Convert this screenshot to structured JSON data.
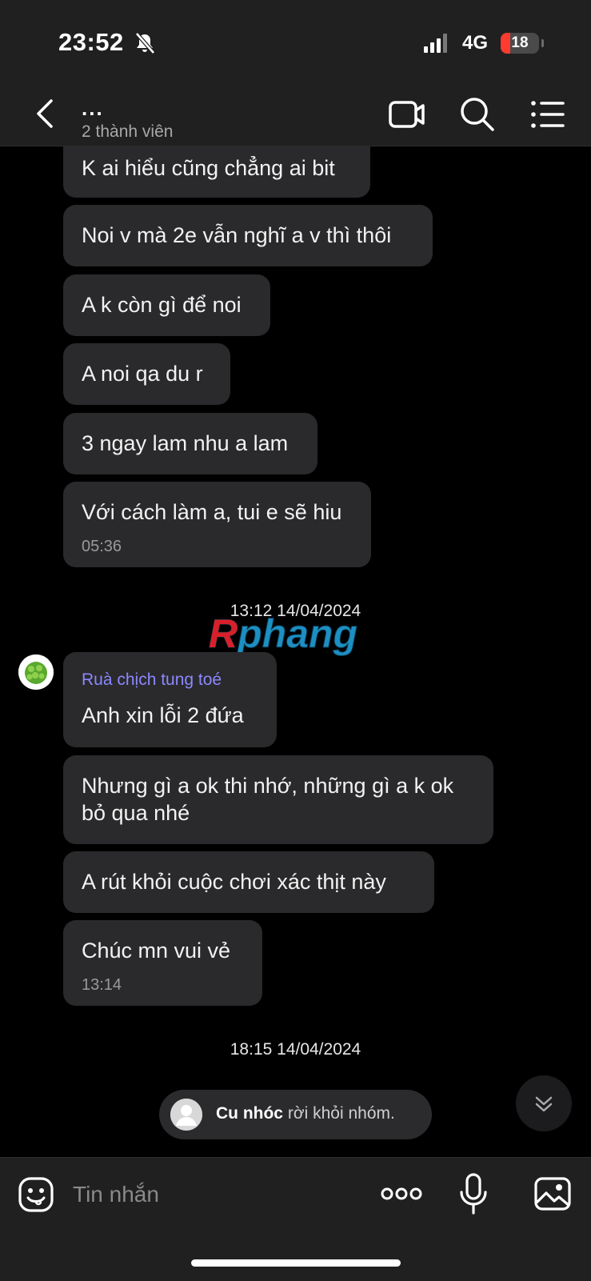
{
  "status_bar": {
    "time": "23:52",
    "network": "4G",
    "battery": "18",
    "icons": [
      "bell-slash-icon",
      "signal-icon"
    ]
  },
  "header": {
    "group_name": "...",
    "member_count": "2 thành viên",
    "icons": [
      "back-icon",
      "video-call-icon",
      "search-icon",
      "menu-list-icon"
    ]
  },
  "messages_before": [
    {
      "text": "K ai hiểu cũng chẳng ai bit"
    },
    {
      "text": "Noi v mà 2e vẫn nghĩ a v thì thôi"
    },
    {
      "text": "A k còn gì để noi"
    },
    {
      "text": "A noi qa du r"
    },
    {
      "text": "3 ngay lam nhu a lam"
    },
    {
      "text": "Với cách làm a, tui e sẽ hiu",
      "time": "05:36"
    }
  ],
  "date_separator_1": "13:12 14/04/2024",
  "watermark": "Rphang",
  "messages_after": [
    {
      "sender": "Ruà chịch tung toé",
      "text": "Anh xin lỗi 2 đứa"
    },
    {
      "text": "Nhưng gì a ok thi nhớ, những gì a k ok bỏ qua nhé"
    },
    {
      "text": "A rút khỏi cuộc chơi xác thịt này"
    },
    {
      "text": "Chúc mn vui vẻ",
      "time": "13:14"
    }
  ],
  "date_separator_2": "18:15 14/04/2024",
  "system_notice": {
    "name": "Cu nhóc",
    "action": " rời khỏi nhóm."
  },
  "composer": {
    "placeholder": "Tin nhắn",
    "icons": [
      "emoji-icon",
      "more-options-icon",
      "microphone-icon",
      "image-icon"
    ]
  },
  "colors": {
    "background": "#000000",
    "bar": "#202020",
    "bubble": "#2a2a2c",
    "sender_name": "#8c88ff"
  }
}
